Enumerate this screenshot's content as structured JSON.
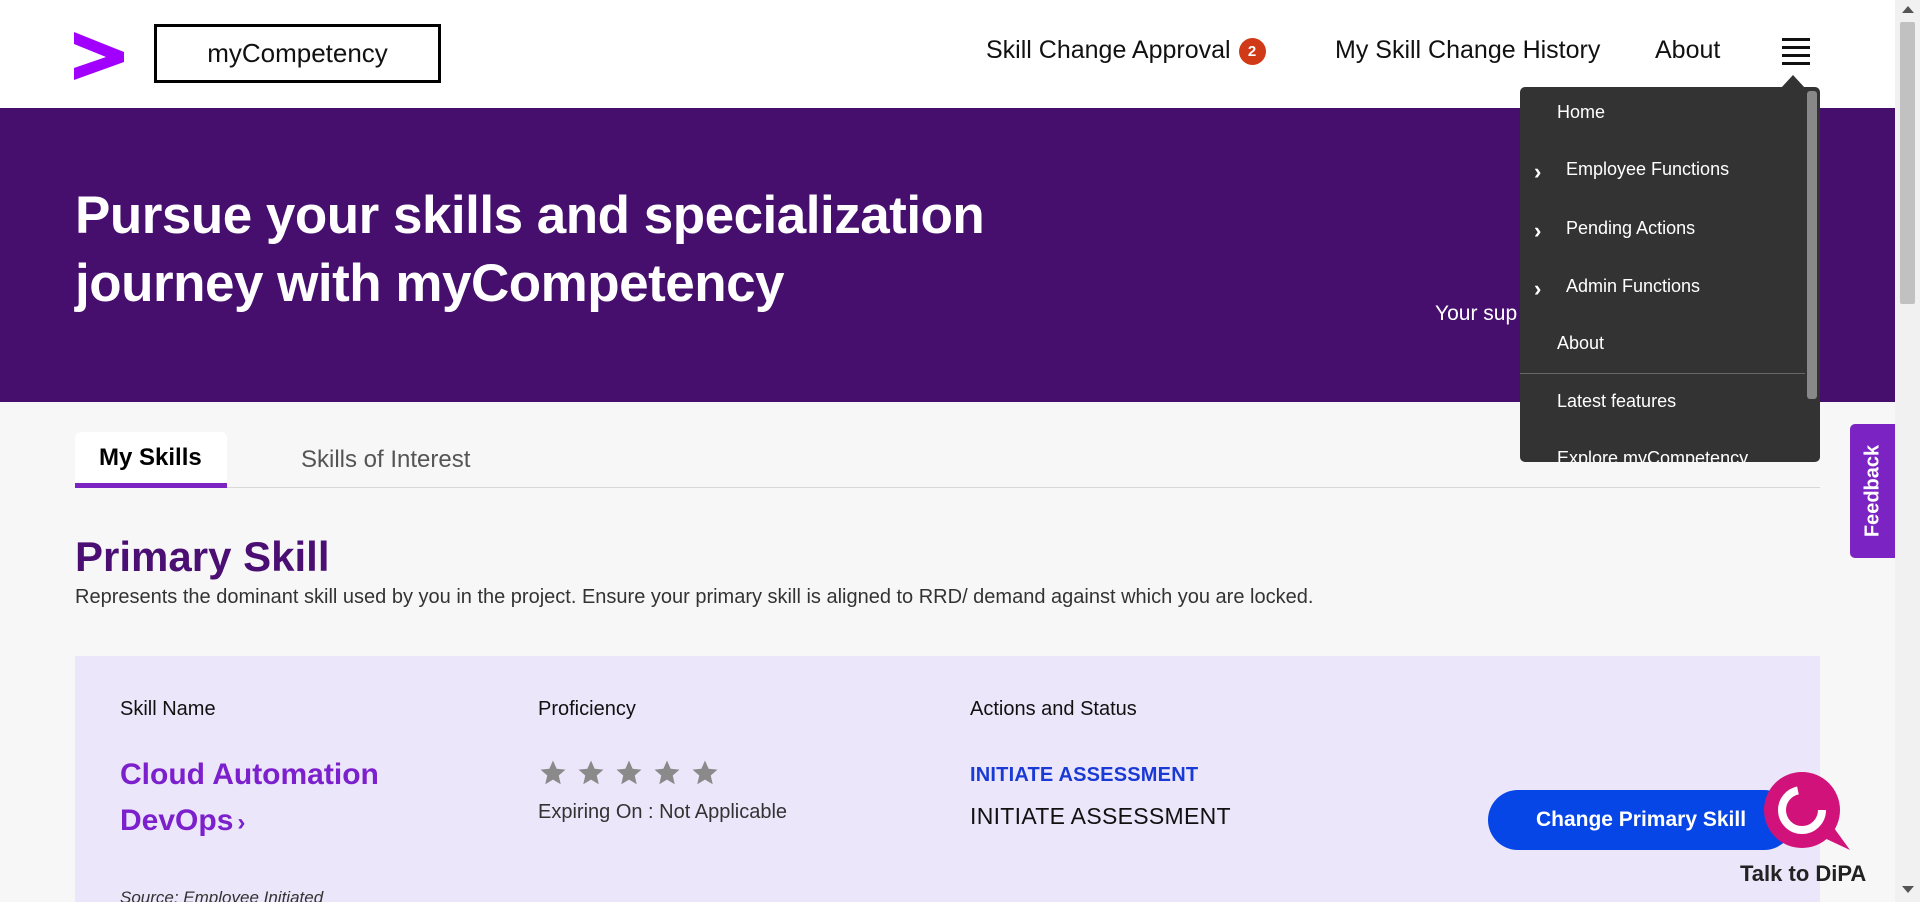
{
  "header": {
    "brand": "myCompetency",
    "nav": {
      "approval_label": "Skill Change Approval",
      "approval_count": "2",
      "history_label": "My Skill Change History",
      "about_label": "About"
    }
  },
  "hero": {
    "title_line1": "Pursue your skills and specialization",
    "title_line2": "journey with myCompetency",
    "subtitle_partial": "Your sup"
  },
  "tabs": [
    {
      "label": "My Skills",
      "active": true
    },
    {
      "label": "Skills of Interest",
      "active": false
    }
  ],
  "primary_skill": {
    "title": "Primary Skill",
    "description": "Represents the dominant skill used by you in the project. Ensure your primary skill is aligned to RRD/ demand against which you are locked.",
    "columns": {
      "name": "Skill Name",
      "proficiency": "Proficiency",
      "actions": "Actions and Status"
    },
    "skill_name": "Cloud Automation DevOps",
    "skill_chevron": "›",
    "proficiency_stars_filled": 0,
    "proficiency_stars_total": 5,
    "expiring": "Expiring On : Not Applicable",
    "assess_link": "INITIATE ASSESSMENT",
    "assess_status": "INITIATE ASSESSMENT",
    "change_button": "Change Primary Skill",
    "source": "Source: Employee Initiated"
  },
  "menu": {
    "items": [
      {
        "label": "Home",
        "has_sub": false
      },
      {
        "label": "Employee Functions",
        "has_sub": true
      },
      {
        "label": "Pending Actions",
        "has_sub": true
      },
      {
        "label": "Admin Functions",
        "has_sub": true
      },
      {
        "label": "About",
        "has_sub": false
      },
      {
        "label": "Latest features",
        "has_sub": false
      },
      {
        "label": "Explore myCompetency",
        "has_sub": false
      }
    ]
  },
  "feedback_label": "Feedback",
  "dipa_label": "Talk to DiPA",
  "colors": {
    "hero_bg": "#460e6d",
    "accent_purple": "#7c23c4",
    "button_blue": "#0645e6",
    "badge_red": "#d13a16",
    "menu_bg": "#333333"
  },
  "icons": [
    "accenture-logo-icon",
    "hamburger-menu-icon",
    "chevron-right-icon",
    "star-icon",
    "dipa-chat-icon"
  ]
}
